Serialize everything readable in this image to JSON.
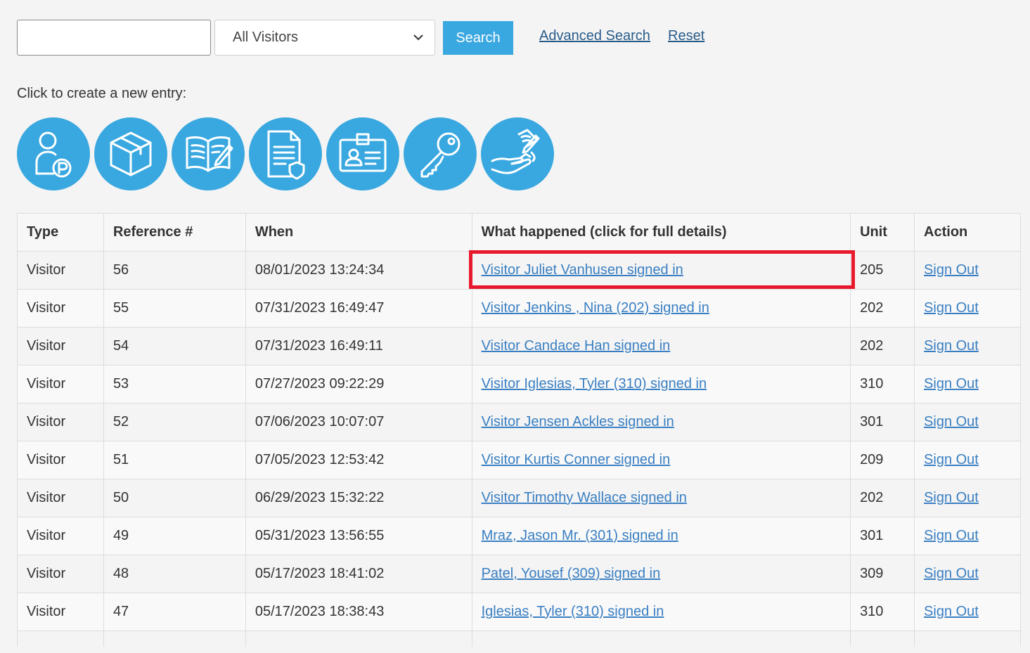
{
  "search": {
    "input_value": "",
    "filter_selected": "All Visitors",
    "button_label": "Search",
    "advanced_link": "Advanced Search",
    "reset_link": "Reset"
  },
  "create": {
    "label": "Click to create a new entry:",
    "icons": [
      "visitor-parking-icon",
      "package-icon",
      "logbook-icon",
      "document-shield-icon",
      "id-badge-icon",
      "key-icon",
      "signature-handoff-icon"
    ]
  },
  "colors": {
    "accent": "#3aa8e0",
    "link": "#3a7fc2",
    "highlight": "#e8192c"
  },
  "table": {
    "headers": {
      "type": "Type",
      "ref": "Reference #",
      "when": "When",
      "what": "What happened (click for full details)",
      "unit": "Unit",
      "action": "Action"
    },
    "rows": [
      {
        "type": "Visitor",
        "ref": "56",
        "when": "08/01/2023 13:24:34",
        "what": "Visitor Juliet Vanhusen signed in",
        "unit": "205",
        "action": "Sign Out"
      },
      {
        "type": "Visitor",
        "ref": "55",
        "when": "07/31/2023 16:49:47",
        "what": "Visitor Jenkins , Nina (202) signed in",
        "unit": "202",
        "action": "Sign Out"
      },
      {
        "type": "Visitor",
        "ref": "54",
        "when": "07/31/2023 16:49:11",
        "what": "Visitor Candace Han signed in",
        "unit": "202",
        "action": "Sign Out"
      },
      {
        "type": "Visitor",
        "ref": "53",
        "when": "07/27/2023 09:22:29",
        "what": "Visitor Iglesias, Tyler (310) signed in",
        "unit": "310",
        "action": "Sign Out"
      },
      {
        "type": "Visitor",
        "ref": "52",
        "when": "07/06/2023 10:07:07",
        "what": "Visitor Jensen Ackles signed in",
        "unit": "301",
        "action": "Sign Out"
      },
      {
        "type": "Visitor",
        "ref": "51",
        "when": "07/05/2023 12:53:42",
        "what": "Visitor Kurtis Conner signed in",
        "unit": "209",
        "action": "Sign Out"
      },
      {
        "type": "Visitor",
        "ref": "50",
        "when": "06/29/2023 15:32:22",
        "what": "Visitor Timothy Wallace signed in",
        "unit": "202",
        "action": "Sign Out"
      },
      {
        "type": "Visitor",
        "ref": "49",
        "when": "05/31/2023 13:56:55",
        "what": "Mraz, Jason Mr. (301) signed in",
        "unit": "301",
        "action": "Sign Out"
      },
      {
        "type": "Visitor",
        "ref": "48",
        "when": "05/17/2023 18:41:02",
        "what": "Patel, Yousef (309) signed in",
        "unit": "309",
        "action": "Sign Out"
      },
      {
        "type": "Visitor",
        "ref": "47",
        "when": "05/17/2023 18:38:43",
        "what": "Iglesias, Tyler (310) signed in",
        "unit": "310",
        "action": "Sign Out"
      }
    ]
  }
}
